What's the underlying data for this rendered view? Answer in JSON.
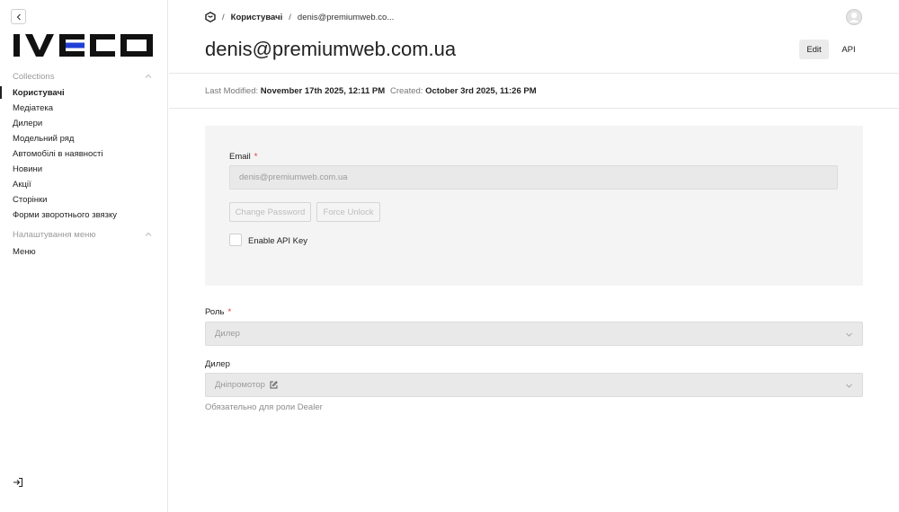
{
  "sidebar": {
    "logo_text": "IVECO",
    "groups": [
      {
        "label": "Collections",
        "items": [
          "Користувачі",
          "Медіатека",
          "Дилери",
          "Модельний ряд",
          "Автомобілі в наявності",
          "Новини",
          "Акції",
          "Сторінки",
          "Форми зворотнього звязку"
        ]
      },
      {
        "label": "Налаштування меню",
        "items": [
          "Меню"
        ]
      }
    ],
    "active_item": "Користувачі"
  },
  "breadcrumb": {
    "home_icon": "home-icon",
    "items": [
      "Користувачі",
      "denis@premiumweb.co..."
    ]
  },
  "page": {
    "title": "denis@premiumweb.com.ua",
    "tabs": [
      "Edit",
      "API"
    ],
    "active_tab": "Edit",
    "last_modified_label": "Last Modified:",
    "last_modified_value": "November 17th 2025, 12:11 PM",
    "created_label": "Created:",
    "created_value": "October 3rd 2025, 11:26 PM"
  },
  "form": {
    "email_label": "Email",
    "required_mark": "*",
    "email_value": "denis@premiumweb.com.ua",
    "change_password_label": "Change Password",
    "force_unlock_label": "Force Unlock",
    "enable_api_key_label": "Enable API Key",
    "role_label": "Роль",
    "role_value": "Дилер",
    "dealer_label": "Дилер",
    "dealer_value": "Дніпромотор",
    "dealer_hint": "Обязательно для роли Dealer"
  },
  "colors": {
    "accent_blue": "#1f3fd6",
    "text": "#222222",
    "required": "#dd3333"
  }
}
